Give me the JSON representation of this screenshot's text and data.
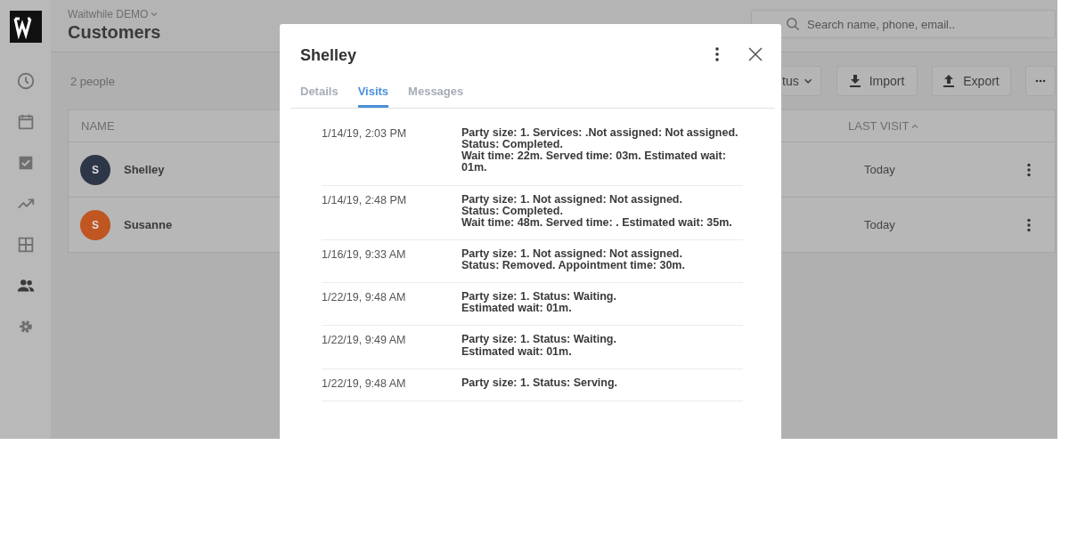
{
  "header": {
    "workspace": "Waitwhile DEMO",
    "title": "Customers"
  },
  "search": {
    "placeholder": "Search name, phone, email.."
  },
  "sidebar": {
    "items": [
      {
        "kind": "clock",
        "selected": false
      },
      {
        "kind": "calendar",
        "selected": false
      },
      {
        "kind": "check",
        "selected": false
      },
      {
        "kind": "trend",
        "selected": false
      },
      {
        "kind": "grid",
        "selected": false
      },
      {
        "kind": "people",
        "selected": true
      },
      {
        "kind": "gear",
        "selected": false
      }
    ]
  },
  "count": "2 people",
  "toolbar": {
    "status_button": "tus",
    "import_button": "Import",
    "export_button": "Export"
  },
  "table": {
    "columns": [
      {
        "label": "NAME"
      },
      {
        "label": "LAST VISIT"
      }
    ],
    "rows": [
      {
        "initial": "S",
        "name": "Shelley",
        "color": "#2d3748",
        "last_visit": "Today"
      },
      {
        "initial": "S",
        "name": "Susanne",
        "color": "#c05621",
        "last_visit": "Today"
      }
    ]
  },
  "modal": {
    "title": "Shelley",
    "tabs": [
      {
        "label": "Details",
        "selected": false
      },
      {
        "label": "Visits",
        "selected": true
      },
      {
        "label": "Messages",
        "selected": false
      }
    ],
    "visits": [
      {
        "time": "1/14/19, 2:03 PM",
        "lines": [
          "Party size: 1. Services: .Not assigned: Not assigned.",
          "Status: Completed.",
          "Wait time: 22m. Served time: 03m. Estimated wait: 01m."
        ]
      },
      {
        "time": "1/14/19, 2:48 PM",
        "lines": [
          "Party size: 1. Not assigned: Not assigned.",
          "Status: Completed.",
          "Wait time: 48m. Served time: . Estimated wait: 35m."
        ]
      },
      {
        "time": "1/16/19, 9:33 AM",
        "lines": [
          "Party size: 1. Not assigned: Not assigned.",
          "Status: Removed. Appointment time: 30m."
        ]
      },
      {
        "time": "1/22/19, 9:48 AM",
        "lines": [
          "Party size: 1. Status: Waiting.",
          "Estimated wait: 01m."
        ]
      },
      {
        "time": "1/22/19, 9:49 AM",
        "lines": [
          "Party size: 1. Status: Waiting.",
          "Estimated wait: 01m."
        ]
      },
      {
        "time": "1/22/19, 9:48 AM",
        "lines": [
          "Party size: 1. Status: Serving."
        ]
      }
    ]
  }
}
